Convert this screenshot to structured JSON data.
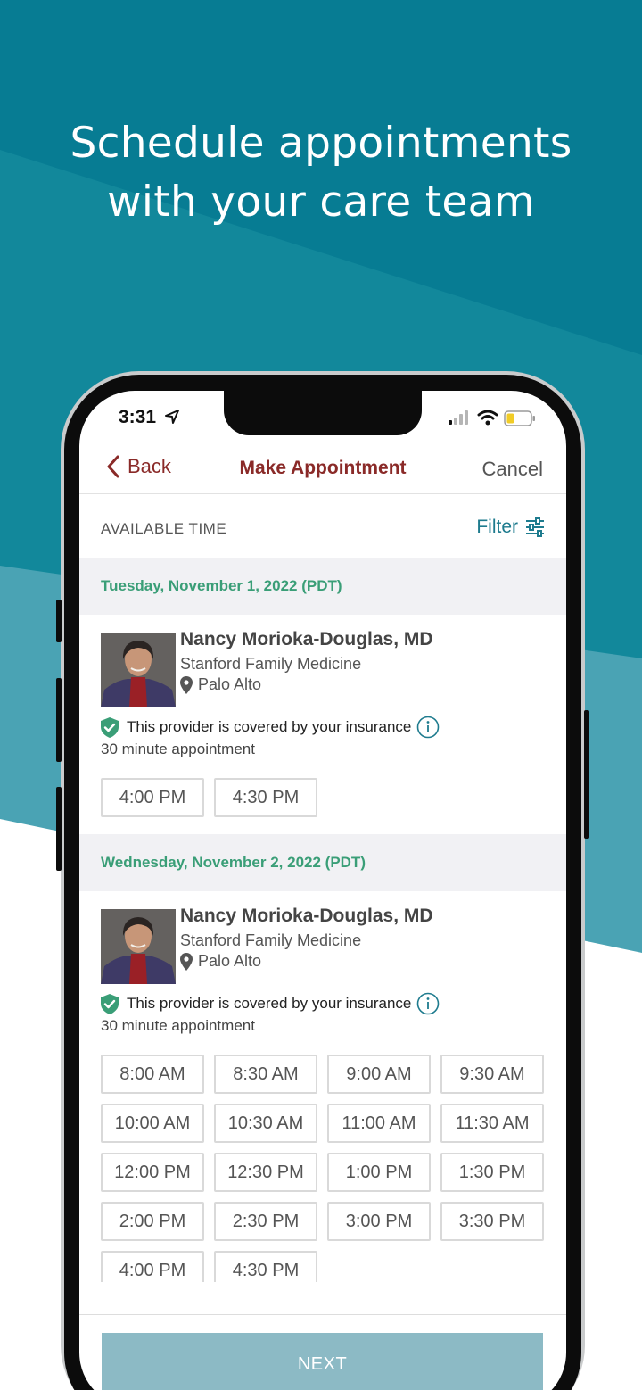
{
  "headline": {
    "line1": "Schedule appointments",
    "line2": "with your care team"
  },
  "colors": {
    "bg_dark_teal": "#077c93",
    "bg_mid_teal": "#12889b",
    "bg_light_teal": "#4aa3b4",
    "accent_maroon": "#8a2a28",
    "date_green": "#3a9e77",
    "filter_blue": "#1e7b8e",
    "next_button": "#8cbac5"
  },
  "status_bar": {
    "time": "3:31",
    "icons": [
      "location-arrow-icon",
      "signal-icon",
      "wifi-icon",
      "battery-icon"
    ]
  },
  "nav": {
    "back_label": "Back",
    "title": "Make Appointment",
    "cancel_label": "Cancel"
  },
  "available": {
    "label": "AVAILABLE TIME",
    "filter_label": "Filter"
  },
  "days": [
    {
      "date": "Tuesday, November 1, 2022 (PDT)",
      "provider": {
        "name": "Nancy Morioka-Douglas, MD",
        "clinic": "Stanford Family Medicine",
        "location": "Palo Alto",
        "coverage": "This provider is covered by your insurance",
        "duration": "30 minute appointment"
      },
      "slots": [
        "4:00 PM",
        "4:30 PM"
      ]
    },
    {
      "date": "Wednesday, November 2, 2022 (PDT)",
      "provider": {
        "name": "Nancy Morioka-Douglas, MD",
        "clinic": "Stanford Family Medicine",
        "location": "Palo Alto",
        "coverage": "This provider is covered by your insurance",
        "duration": "30 minute appointment"
      },
      "slots": [
        "8:00 AM",
        "8:30 AM",
        "9:00 AM",
        "9:30 AM",
        "10:00 AM",
        "10:30 AM",
        "11:00 AM",
        "11:30 AM",
        "12:00 PM",
        "12:30 PM",
        "1:00 PM",
        "1:30 PM",
        "2:00 PM",
        "2:30 PM",
        "3:00 PM",
        "3:30 PM",
        "4:00 PM",
        "4:30 PM"
      ]
    }
  ],
  "next_label": "NEXT"
}
